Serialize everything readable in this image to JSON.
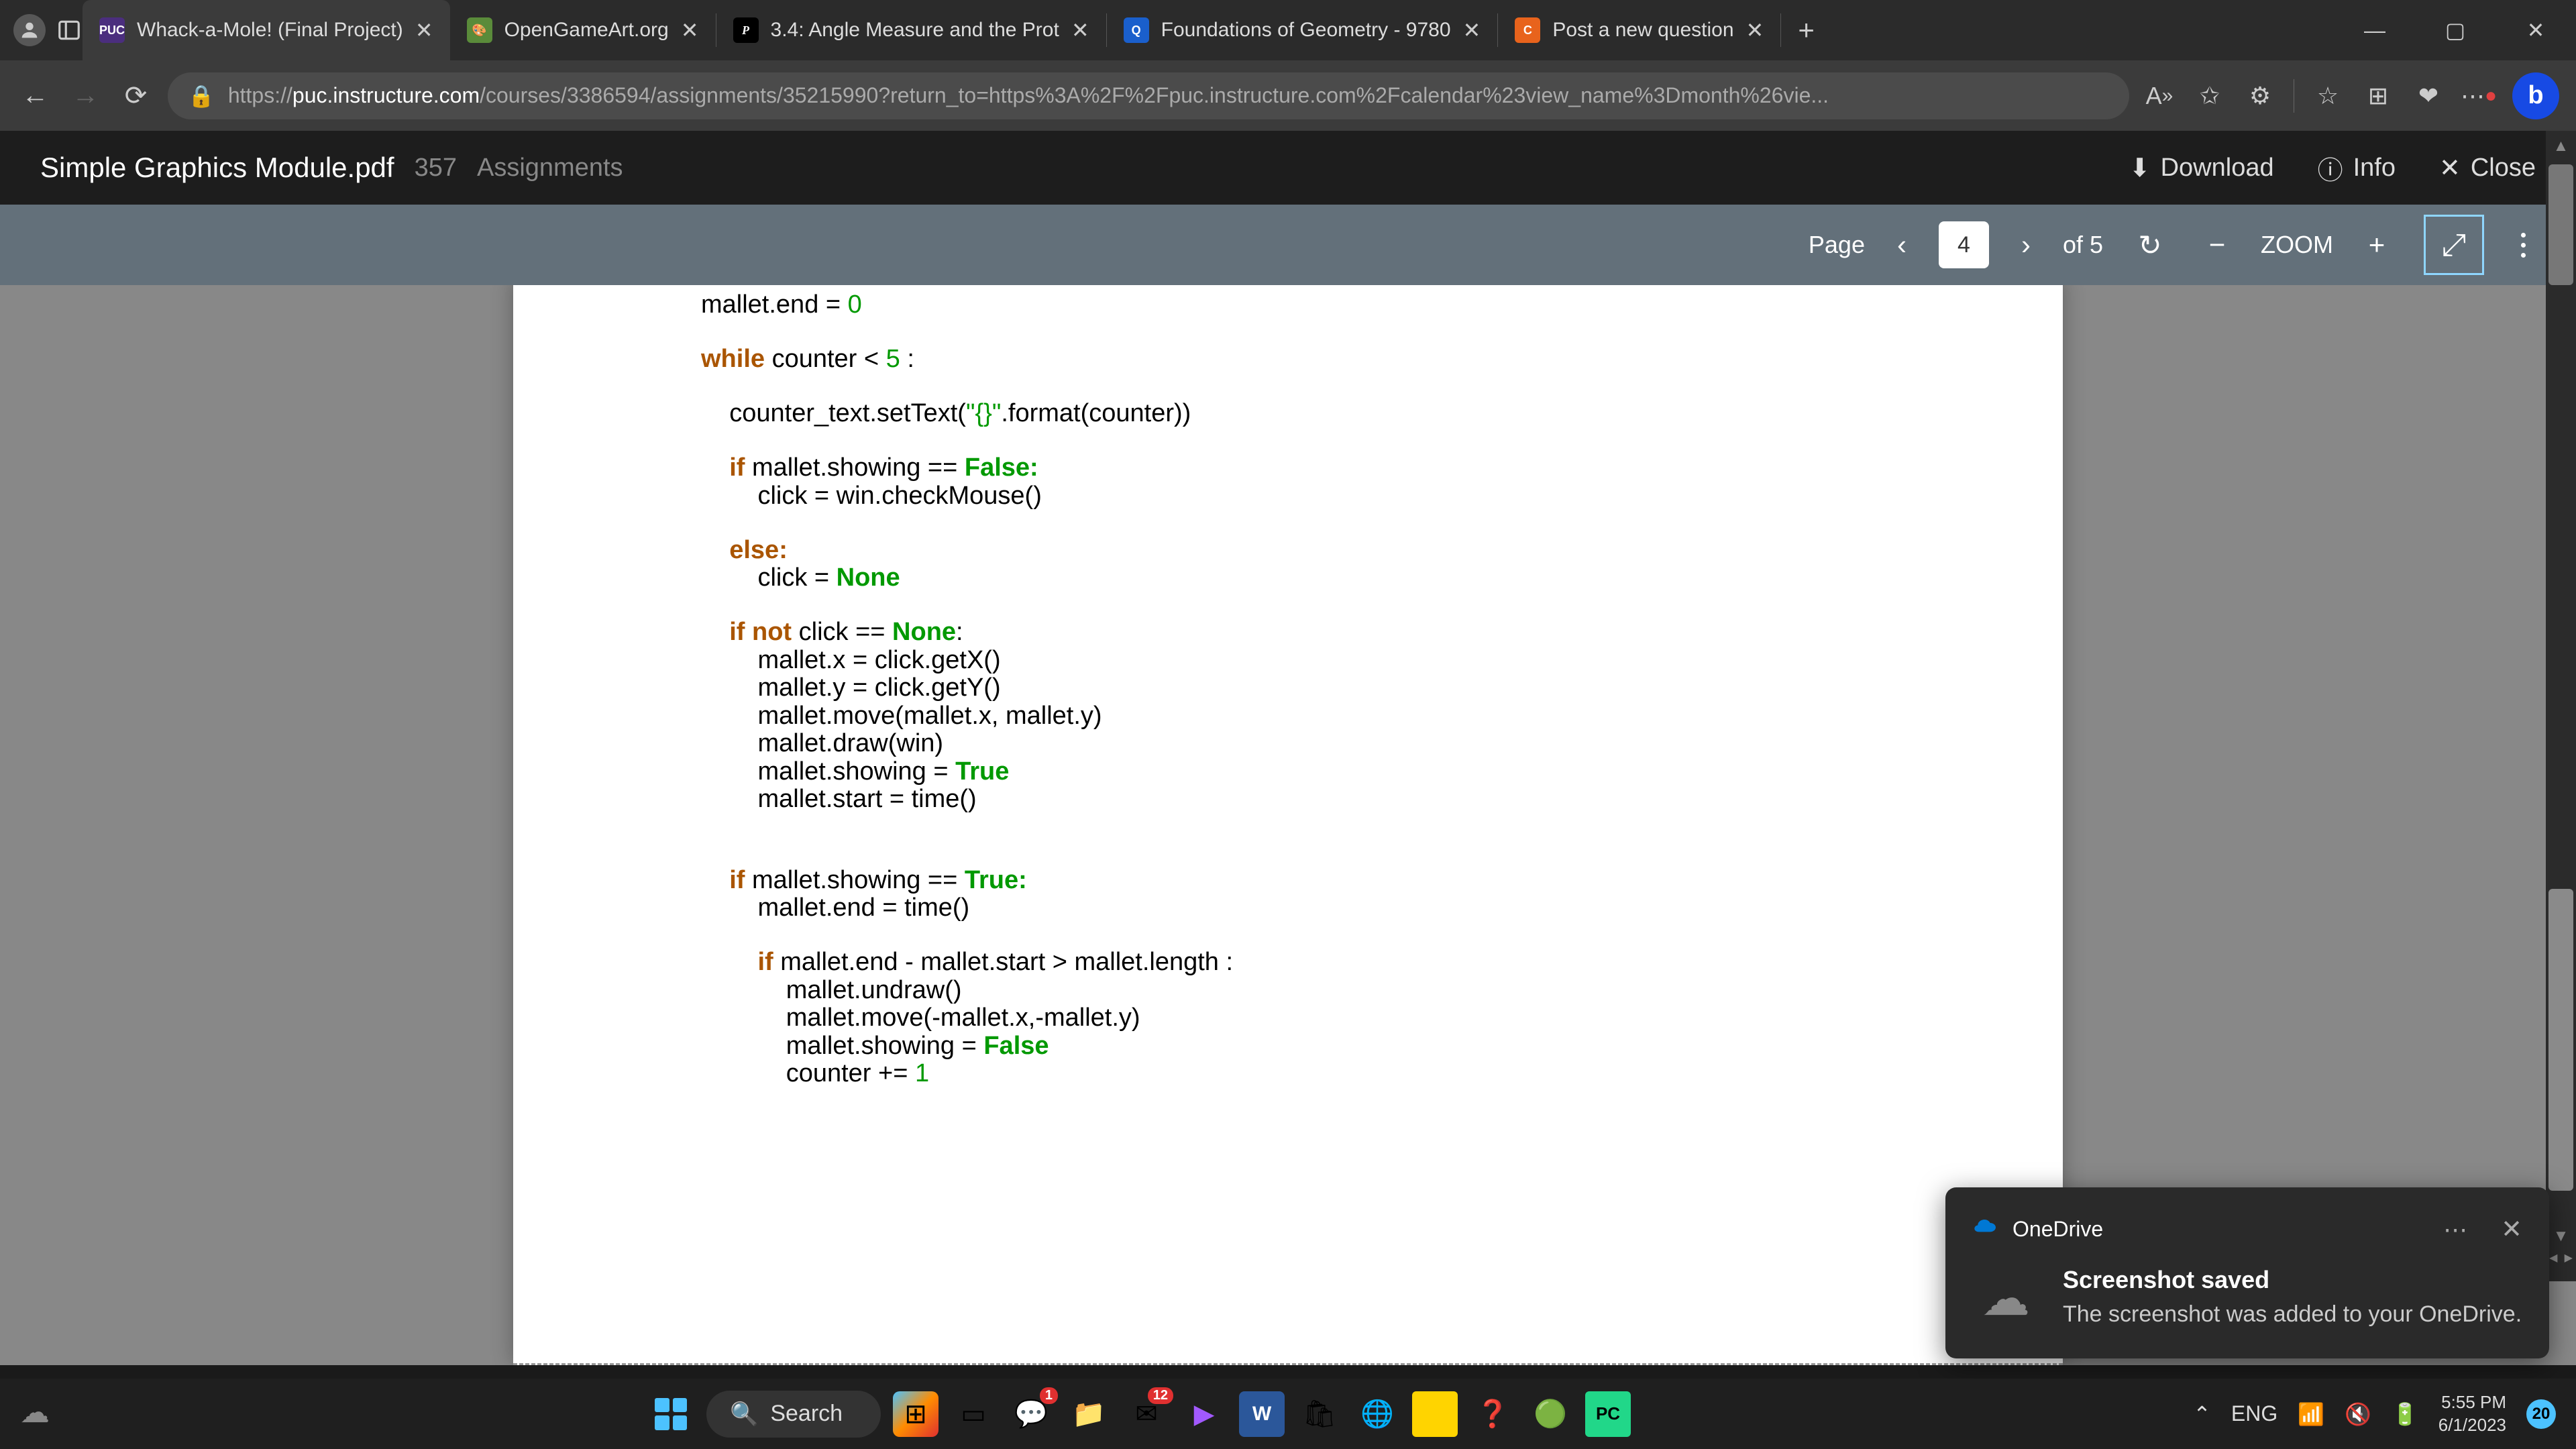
{
  "browser": {
    "tabs": [
      {
        "title": "Whack-a-Mole! (Final Project)",
        "favicon_bg": "#4b2e7e",
        "favicon_text": "PUC",
        "favicon_color": "#fff"
      },
      {
        "title": "OpenGameArt.org",
        "favicon_bg": "#3a6b2a",
        "favicon_text": "🎨",
        "favicon_color": "#fff"
      },
      {
        "title": "3.4: Angle Measure and the Prot",
        "favicon_bg": "#1a1a1a",
        "favicon_text": "P",
        "favicon_color": "#fff"
      },
      {
        "title": "Foundations of Geometry - 9780",
        "favicon_bg": "#1a5fcc",
        "favicon_text": "Q",
        "favicon_color": "#fff"
      },
      {
        "title": "Post a new question",
        "favicon_bg": "#e8631c",
        "favicon_text": "C",
        "favicon_color": "#fff"
      }
    ],
    "url_host": "puc.instructure.com",
    "url_path": "/courses/3386594/assignments/35215990?return_to=https%3A%2F%2Fpuc.instructure.com%2Fcalendar%23view_name%3Dmonth%26vie...",
    "url_prefix": "https://"
  },
  "pdf": {
    "title": "Simple Graphics Module.pdf",
    "breadcrumb_course": "357",
    "breadcrumb_section": "Assignments",
    "download": "Download",
    "info": "Info",
    "close": "Close",
    "page_label": "Page",
    "page_current": "4",
    "page_total": "of 5",
    "zoom_label": "ZOOM"
  },
  "code": {
    "l00": "mallet.end = ",
    "l00v": "0",
    "l01a": "while",
    "l01b": " counter < ",
    "l01c": "5",
    "l01d": " :",
    "l02a": "    counter_text.setText(",
    "l02b": "\"{}\"",
    "l02c": ".format(counter))",
    "l03a": "    ",
    "l03b": "if",
    "l03c": " mallet.showing == ",
    "l03d": "False:",
    "l04": "        click = win.checkMouse()",
    "l05a": "    ",
    "l05b": "else:",
    "l06a": "        click = ",
    "l06b": "None",
    "l07a": "    ",
    "l07b": "if not",
    "l07c": " click == ",
    "l07d": "None",
    "l07e": ":",
    "l08": "        mallet.x = click.getX()",
    "l09": "        mallet.y = click.getY()",
    "l10": "        mallet.move(mallet.x, mallet.y)",
    "l11": "        mallet.draw(win)",
    "l12a": "        mallet.showing = ",
    "l12b": "True",
    "l13": "        mallet.start = time()",
    "l14a": "    ",
    "l14b": "if",
    "l14c": " mallet.showing == ",
    "l14d": "True:",
    "l15": "        mallet.end = time()",
    "l16a": "        ",
    "l16b": "if",
    "l16c": " mallet.end - mallet.start > mallet.length :",
    "l17": "            mallet.undraw()",
    "l18": "            mallet.move(-mallet.x,-mallet.y)",
    "l19a": "            mallet.showing = ",
    "l19b": "False",
    "l20a": "            counter += ",
    "l20b": "1"
  },
  "notification": {
    "app": "OneDrive",
    "title": "Screenshot saved",
    "desc": "The screenshot was added to your OneDrive."
  },
  "taskbar": {
    "search": "Search",
    "lang": "ENG",
    "time": "5:55 PM",
    "date": "6/1/2023",
    "notif_count": "20",
    "mail_badge": "12",
    "teams_badge": "1"
  }
}
